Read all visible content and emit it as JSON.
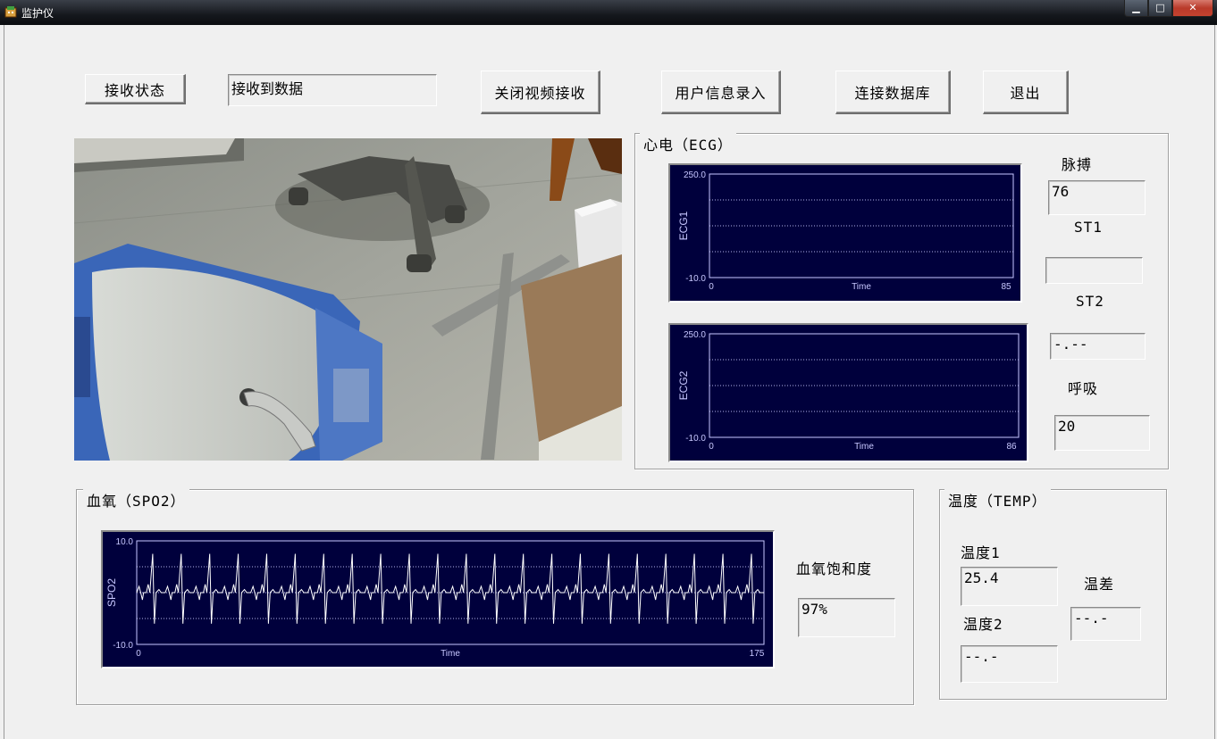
{
  "window": {
    "title": "监护仪"
  },
  "toolbar": {
    "receive_status_label": "接收状态",
    "receive_status_value": "接收到数据",
    "close_video_label": "关闭视频接收",
    "user_info_label": "用户信息录入",
    "connect_db_label": "连接数据库",
    "exit_label": "退出"
  },
  "ecg": {
    "group_title": "心电（ECG）",
    "pulse_label": "脉搏",
    "pulse_value": "76",
    "st1_label": "ST1",
    "st1_value": "",
    "st2_label": "ST2",
    "st2_value": "-.--",
    "resp_label": "呼吸",
    "resp_value": "20"
  },
  "spo2": {
    "group_title": "血氧（SPO2）",
    "saturation_label": "血氧饱和度",
    "saturation_value": "97%"
  },
  "temp": {
    "group_title": "温度（TEMP）",
    "temp1_label": "温度1",
    "temp1_value": "25.4",
    "temp2_label": "温度2",
    "temp2_value": "--.-",
    "diff_label": "温差",
    "diff_value": "--.-"
  },
  "colors": {
    "plot_bg": "#00003c",
    "plot_grid": "#c8c8ff",
    "trace": "#ffffff"
  },
  "chart_data": [
    {
      "type": "line",
      "ylabel": "ECG1",
      "xlabel": "Time",
      "xlim": [
        0,
        85
      ],
      "ylim": [
        -10.0,
        250.0
      ],
      "x_tick_labels": [
        "0",
        "85"
      ],
      "y_tick_labels": [
        "250.0",
        "-10.0"
      ],
      "series": []
    },
    {
      "type": "line",
      "ylabel": "ECG2",
      "xlabel": "Time",
      "xlim": [
        0,
        86
      ],
      "ylim": [
        -10.0,
        250.0
      ],
      "x_tick_labels": [
        "0",
        "86"
      ],
      "y_tick_labels": [
        "250.0",
        "-10.0"
      ],
      "series": []
    },
    {
      "type": "line",
      "ylabel": "SPO2",
      "xlabel": "Time",
      "xlim": [
        0,
        175
      ],
      "ylim": [
        -10.0,
        10.0
      ],
      "x_tick_labels": [
        "0",
        "175"
      ],
      "y_tick_labels": [
        "10.0",
        "-10.0"
      ],
      "series": [
        {
          "beats": 22,
          "peak": 7.5,
          "trough": -6.0
        }
      ]
    }
  ]
}
